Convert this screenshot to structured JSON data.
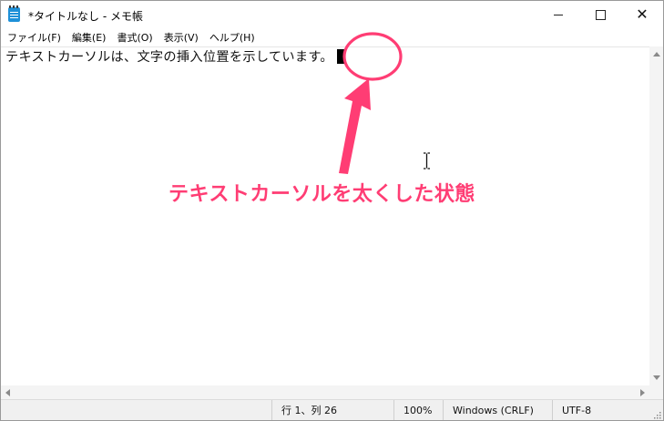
{
  "window": {
    "title": "*タイトルなし - メモ帳"
  },
  "menu": {
    "items": [
      "ファイル(F)",
      "編集(E)",
      "書式(O)",
      "表示(V)",
      "ヘルプ(H)"
    ]
  },
  "editor": {
    "text": "テキストカーソルは、文字の挿入位置を示しています。"
  },
  "statusbar": {
    "position": "行 1、列 26",
    "zoom": "100%",
    "line_ending": "Windows (CRLF)",
    "encoding": "UTF-8"
  },
  "annotation": {
    "caption": "テキストカーソルを太くした状態",
    "color": "#ff3d74"
  },
  "icons": {
    "app": "notepad-icon",
    "minimize": "minimize-icon",
    "maximize": "maximize-icon",
    "close": "close-icon"
  }
}
